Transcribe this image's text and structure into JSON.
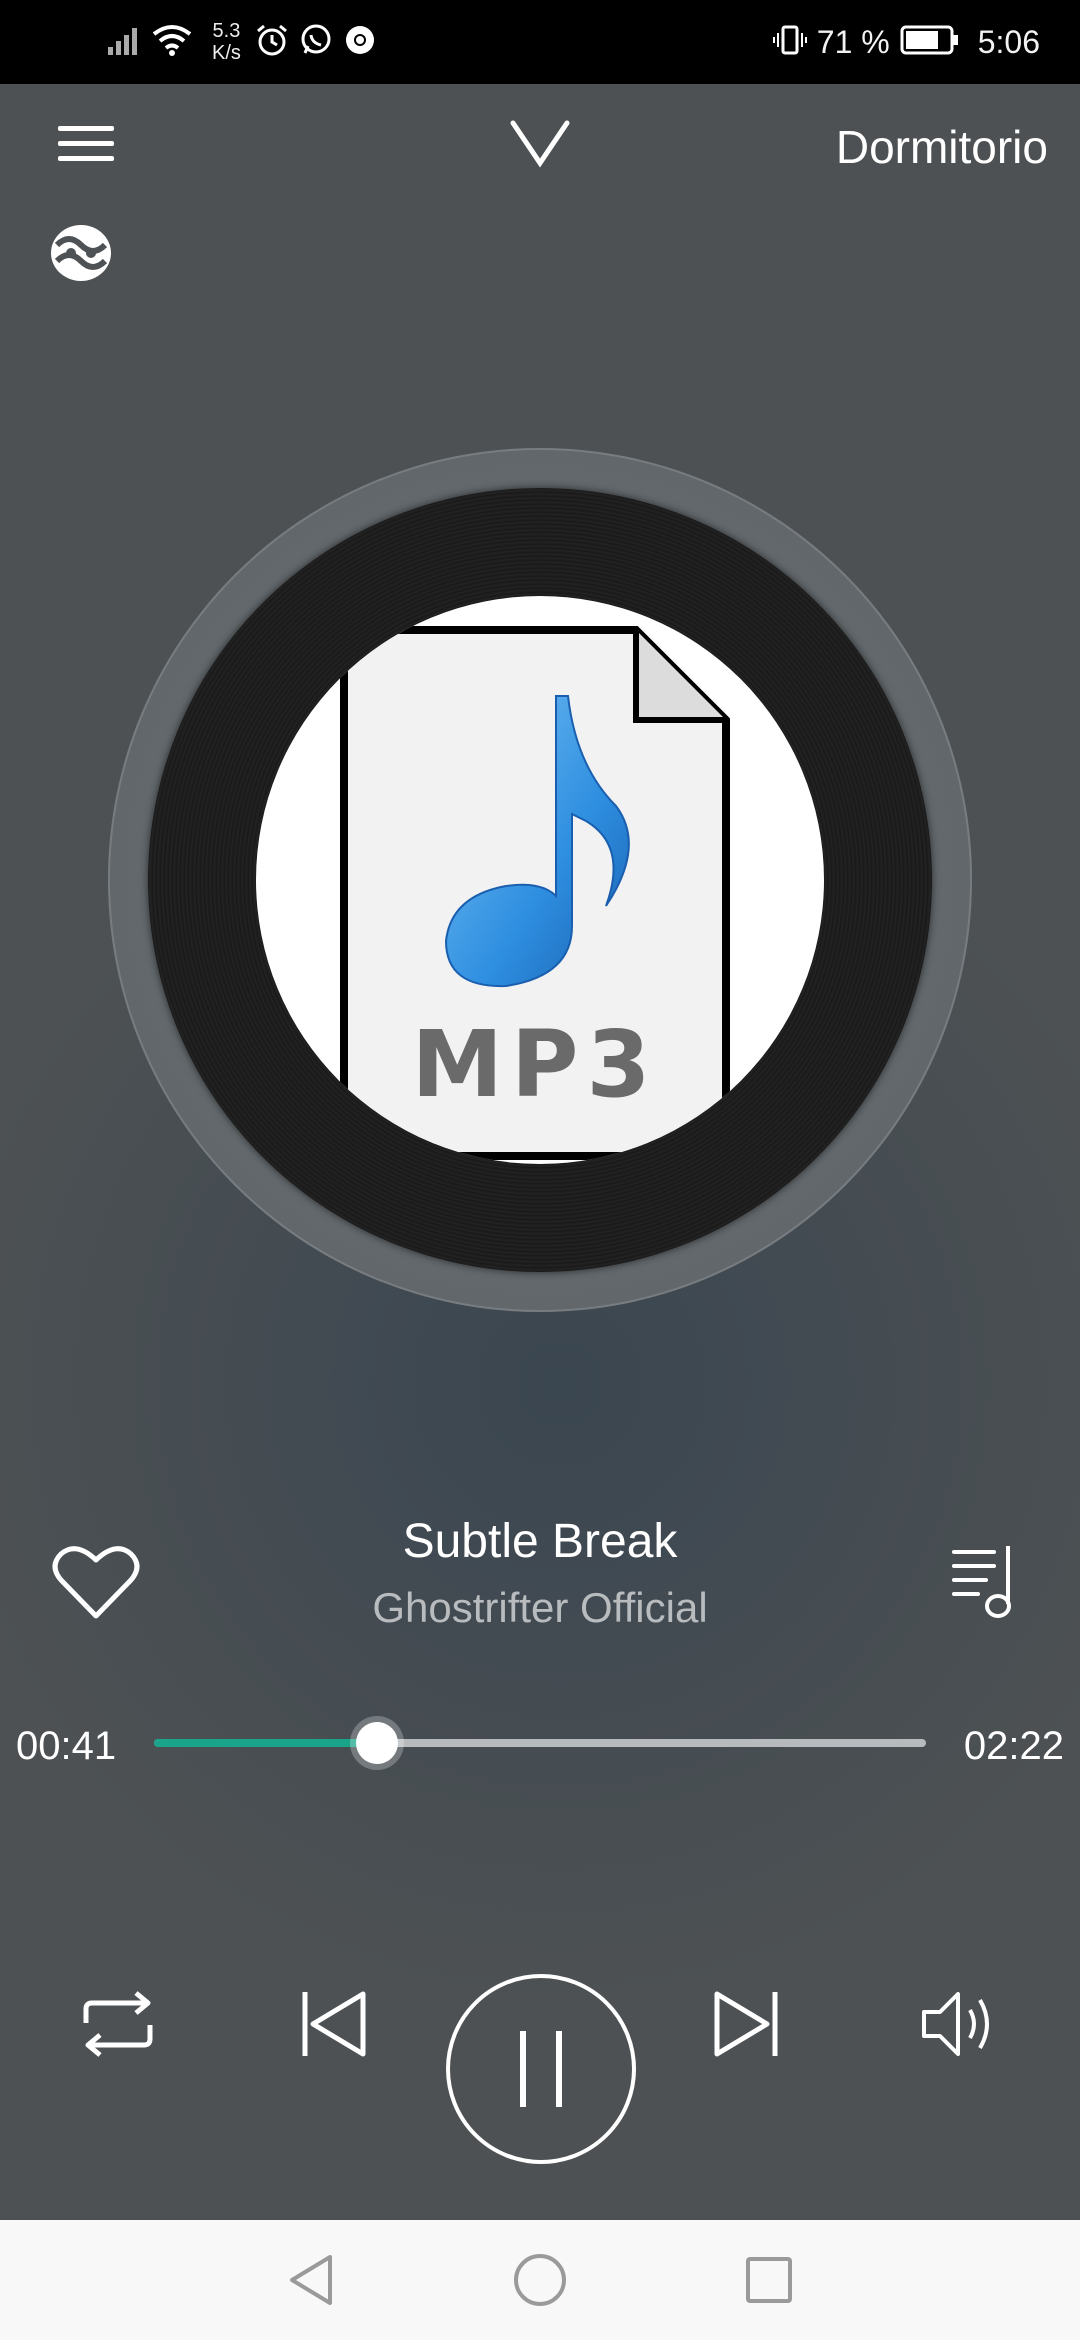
{
  "status_bar": {
    "net_speed_value": "5.3",
    "net_speed_unit": "K/s",
    "battery_percent": "71 %",
    "time": "5:06",
    "icons": [
      "signal-icon",
      "wifi-icon",
      "alarm-icon",
      "whatsapp-icon",
      "chrome-icon",
      "vibrate-icon",
      "battery-icon"
    ]
  },
  "header": {
    "device_name": "Dormitorio",
    "icons": [
      "menu-icon",
      "collapse-chevron-icon",
      "cast-device-icon"
    ]
  },
  "album_art": {
    "label_text": "MP3",
    "icon": "mp3-file-music-note-icon"
  },
  "song": {
    "title": "Subtle Break",
    "artist": "Ghostrifter Official"
  },
  "progress": {
    "elapsed": "00:41",
    "duration": "02:22",
    "fraction": 0.289
  },
  "controls": {
    "icons": [
      "repeat-icon",
      "previous-icon",
      "pause-icon",
      "next-icon",
      "volume-icon",
      "favorite-heart-icon",
      "queue-icon"
    ]
  },
  "colors": {
    "accent": "#1aa489",
    "background": "#4e5254",
    "status_bar": "#000000",
    "nav_bar": "#f8f8f8"
  },
  "nav_bar": {
    "icons": [
      "back-icon",
      "home-icon",
      "recents-icon"
    ]
  }
}
